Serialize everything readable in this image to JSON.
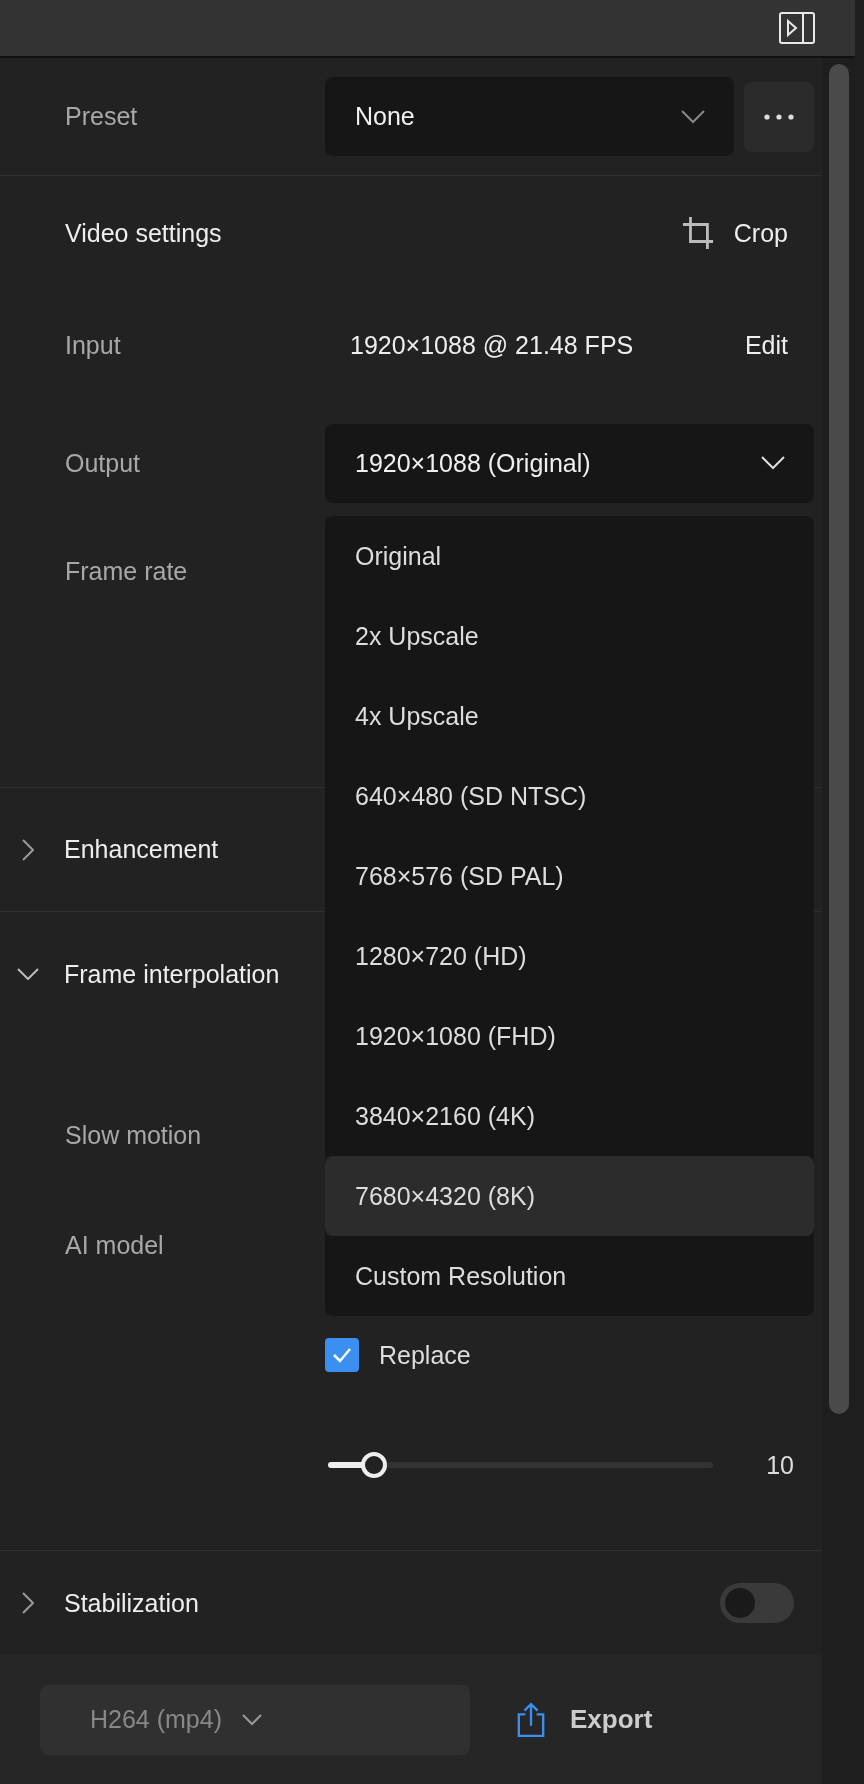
{
  "preset": {
    "label": "Preset",
    "value": "None"
  },
  "video_settings": {
    "title": "Video settings",
    "crop": "Crop",
    "input_label": "Input",
    "input_value": "1920×1088 @ 21.48 FPS",
    "edit": "Edit",
    "output_label": "Output",
    "output_value": "1920×1088 (Original)",
    "frame_rate_label": "Frame rate"
  },
  "output_menu": {
    "items": [
      {
        "label": "Original",
        "selected": false
      },
      {
        "label": "2x Upscale",
        "selected": false
      },
      {
        "label": "4x Upscale",
        "selected": false
      },
      {
        "label": "640×480 (SD NTSC)",
        "selected": false
      },
      {
        "label": "768×576 (SD PAL)",
        "selected": false
      },
      {
        "label": "1280×720 (HD)",
        "selected": false
      },
      {
        "label": "1920×1080 (FHD)",
        "selected": false
      },
      {
        "label": "3840×2160 (4K)",
        "selected": false
      },
      {
        "label": "7680×4320 (8K)",
        "selected": true
      },
      {
        "label": "Custom Resolution",
        "selected": false
      }
    ]
  },
  "enhancement": {
    "title": "Enhancement",
    "expanded": false
  },
  "frame_interpolation": {
    "title": "Frame interpolation",
    "expanded": true,
    "slow_motion_label": "Slow motion",
    "ai_model_label": "AI model",
    "replace": {
      "label": "Replace",
      "checked": true
    },
    "slider": {
      "level": 0.12,
      "reading": "10"
    }
  },
  "stabilization": {
    "title": "Stabilization",
    "expanded": false,
    "on": false
  },
  "bottom_bar": {
    "format": "H264 (mp4)",
    "export": "Export"
  }
}
